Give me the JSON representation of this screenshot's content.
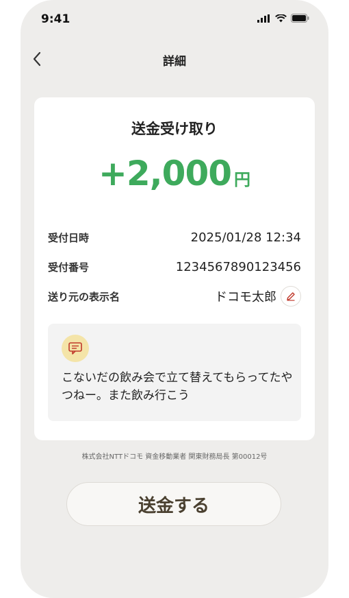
{
  "status_bar": {
    "time": "9:41"
  },
  "header": {
    "title": "詳細",
    "back_icon": "chevron-left-icon"
  },
  "card": {
    "title": "送金受け取り",
    "amount": "+2,000",
    "currency": "円",
    "details": [
      {
        "label": "受付日時",
        "value": "2025/01/28 12:34"
      },
      {
        "label": "受付番号",
        "value": "1234567890123456"
      },
      {
        "label": "送り元の表示名",
        "value": "ドコモ太郎"
      }
    ],
    "message": "こないだの飲み会で立て替えてもらってたやつねー。また飲み行こう"
  },
  "footer": "株式会社NTTドコモ 資金移動業者 関東財務局長 第00012号",
  "send_button_label": "送金する",
  "colors": {
    "accent_green": "#3eaa5c",
    "edit_red": "#c0392b",
    "message_icon_bg": "#f4e4a8"
  }
}
